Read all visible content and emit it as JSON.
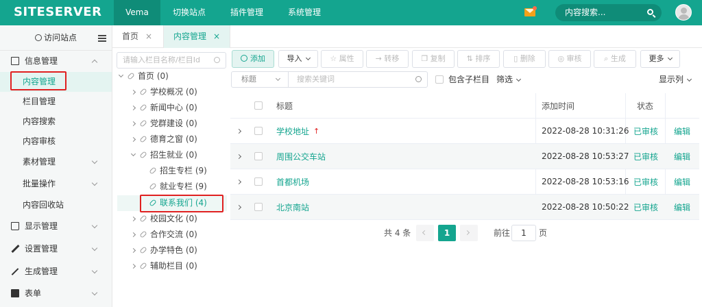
{
  "header": {
    "logo": "SITESERVER",
    "nav": [
      "Vema",
      "切换站点",
      "插件管理",
      "系统管理"
    ],
    "search_placeholder": "内容搜索..."
  },
  "sidebar": {
    "visit": "访问站点",
    "groups": [
      {
        "label": "信息管理",
        "icon": "edit-icon"
      },
      {
        "label": "显示管理",
        "icon": "shirt-icon"
      },
      {
        "label": "设置管理",
        "icon": "wrench-icon"
      },
      {
        "label": "生成管理",
        "icon": "magic-wand-icon"
      },
      {
        "label": "表单",
        "icon": "form-icon"
      }
    ],
    "sub_items": [
      "内容管理",
      "栏目管理",
      "内容搜索",
      "内容审核",
      "素材管理",
      "批量操作",
      "内容回收站"
    ]
  },
  "tabs": [
    {
      "label": "首页",
      "close": "×"
    },
    {
      "label": "内容管理",
      "close": "×"
    }
  ],
  "tree": {
    "search_placeholder": "请输入栏目名称/栏目Id",
    "nodes": [
      "首页 (0)",
      "学校概况 (0)",
      "新闻中心 (0)",
      "党群建设 (0)",
      "德育之窗 (0)",
      "招生就业 (0)",
      "招生专栏 (9)",
      "就业专栏 (9)",
      "联系我们 (4)",
      "校园文化 (0)",
      "合作交流 (0)",
      "办学特色 (0)",
      "辅助栏目 (0)"
    ]
  },
  "toolbar": {
    "buttons": [
      "添加",
      "导入",
      "属性",
      "转移",
      "复制",
      "排序",
      "删除",
      "审核",
      "生成",
      "更多"
    ]
  },
  "filter": {
    "field": "标题",
    "keyword_placeholder": "搜索关键词",
    "include_children": "包含子栏目",
    "filter_label": "筛选",
    "columns_label": "显示列"
  },
  "table": {
    "headers": {
      "title": "标题",
      "date": "添加时间",
      "status": "状态"
    },
    "rows": [
      {
        "title": "学校地址",
        "date": "2022-08-28 10:31:26",
        "status": "已审核",
        "action": "编辑",
        "flag": "↑"
      },
      {
        "title": "周围公交车站",
        "date": "2022-08-28 10:53:27",
        "status": "已审核",
        "action": "编辑",
        "flag": ""
      },
      {
        "title": "首都机场",
        "date": "2022-08-28 10:53:16",
        "status": "已审核",
        "action": "编辑",
        "flag": ""
      },
      {
        "title": "北京南站",
        "date": "2022-08-28 10:50:22",
        "status": "已审核",
        "action": "编辑",
        "flag": ""
      }
    ]
  },
  "pager": {
    "total": "共 4 条",
    "current": "1",
    "goto_prefix": "前往",
    "goto_value": "1",
    "goto_suffix": "页"
  },
  "colors": {
    "accent": "#14a58f",
    "highlight": "#e02020"
  }
}
